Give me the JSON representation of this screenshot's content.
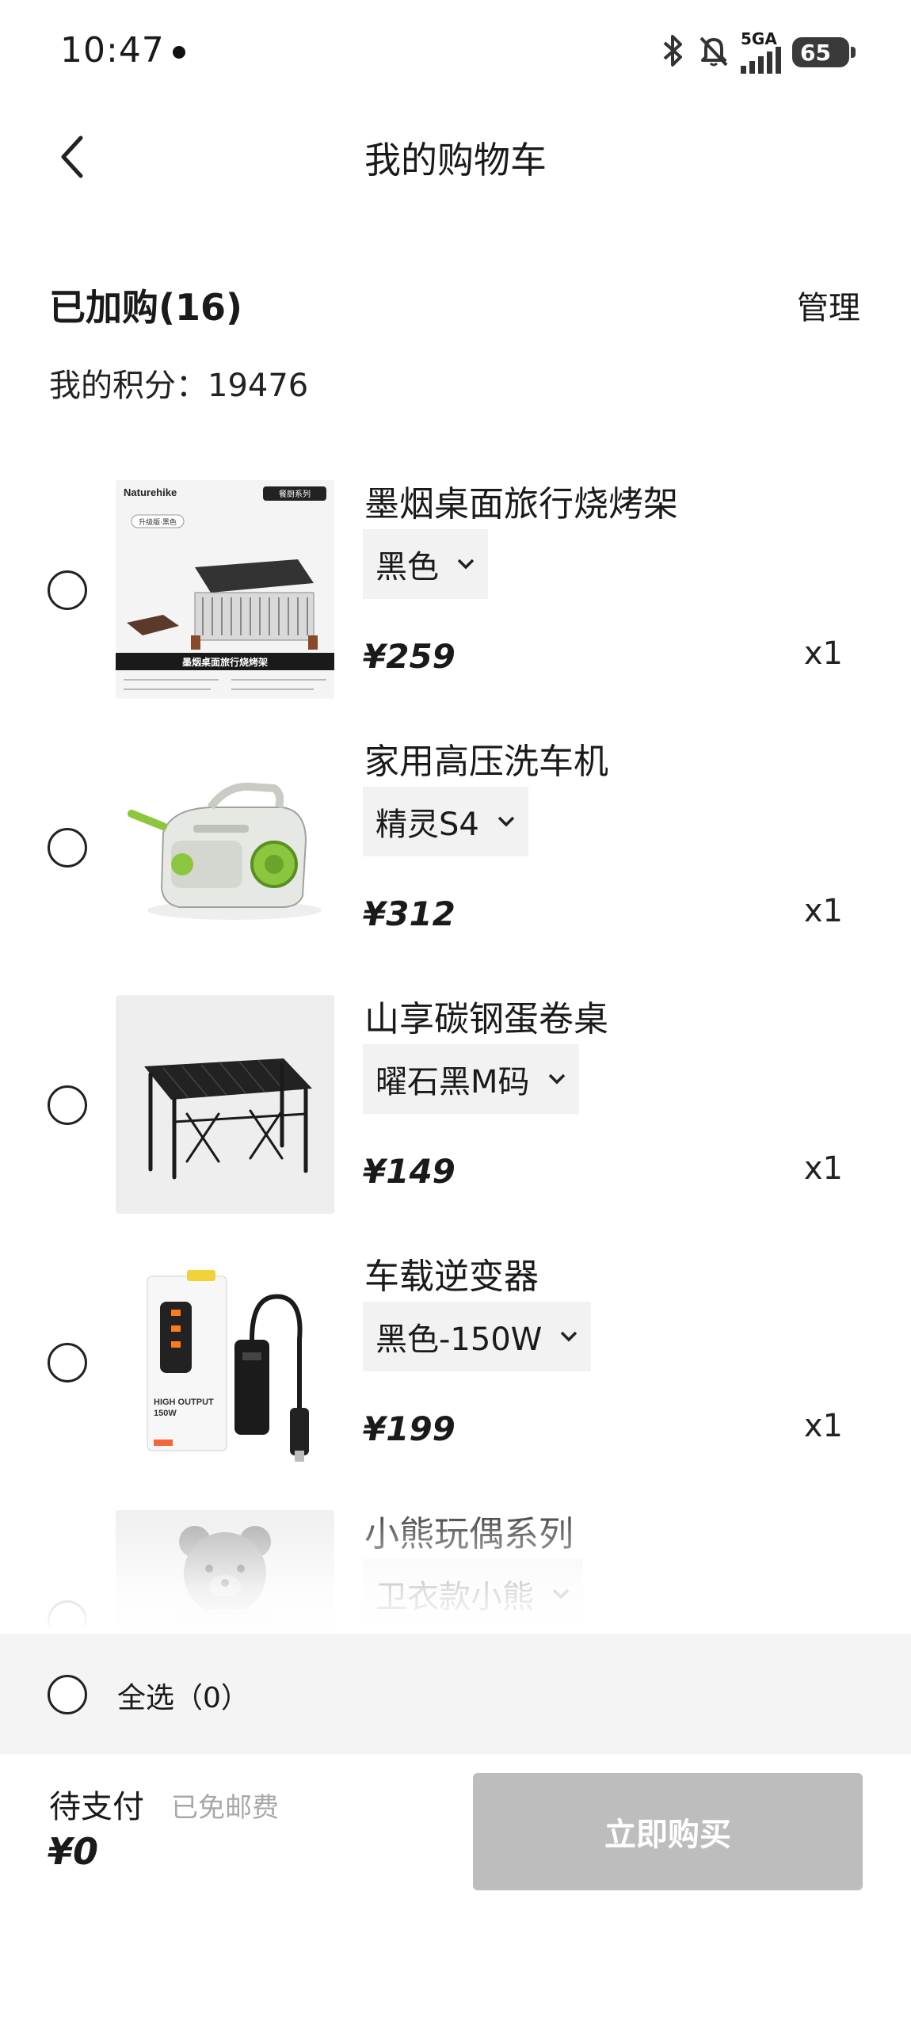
{
  "status_bar": {
    "time": "10:47",
    "network": "5GA",
    "battery": "65",
    "icons": [
      "bluetooth-icon",
      "mute-bell-icon",
      "signal-icon",
      "battery-icon"
    ]
  },
  "header": {
    "title": "我的购物车",
    "back_icon": "chevron-left-icon"
  },
  "summary": {
    "count_label": "已加购(16)",
    "manage_label": "管理",
    "points_label": "我的积分：19476"
  },
  "items": [
    {
      "name": "墨烟桌面旅行烧烤架",
      "spec": "黑色",
      "price": "¥259",
      "qty": "x1",
      "image": "bbq-grill-image"
    },
    {
      "name": "家用高压洗车机",
      "spec": "精灵S4",
      "price": "¥312",
      "qty": "x1",
      "image": "pressure-washer-image"
    },
    {
      "name": "山享碳钢蛋卷桌",
      "spec": "曜石黑M码",
      "price": "¥149",
      "qty": "x1",
      "image": "folding-table-image"
    },
    {
      "name": "车载逆变器",
      "spec": "黑色-150W",
      "price": "¥199",
      "qty": "x1",
      "image": "car-inverter-image"
    },
    {
      "name": "小熊玩偶系列",
      "spec": "卫衣款小熊",
      "price": "",
      "qty": "",
      "image": "teddy-bear-image"
    }
  ],
  "product_image_text": {
    "grill_brand": "Naturehike",
    "grill_badge": "升级版·黑色",
    "grill_series": "餐厨系列",
    "grill_caption": "墨烟桌面旅行烧烤架",
    "inverter_label": "HIGH OUTPUT",
    "inverter_power": "150W"
  },
  "select_all": {
    "label": "全选（0）"
  },
  "footer": {
    "pending_label": "待支付",
    "shipping_label": "已免邮费",
    "total": "¥0",
    "buy_label": "立即购买"
  },
  "colors": {
    "buy_button_disabled": "#bdbdbd",
    "select_bar_bg": "#f4f4f4",
    "spec_bg": "#f2f2f2",
    "muted_text": "#a8a8a8"
  }
}
